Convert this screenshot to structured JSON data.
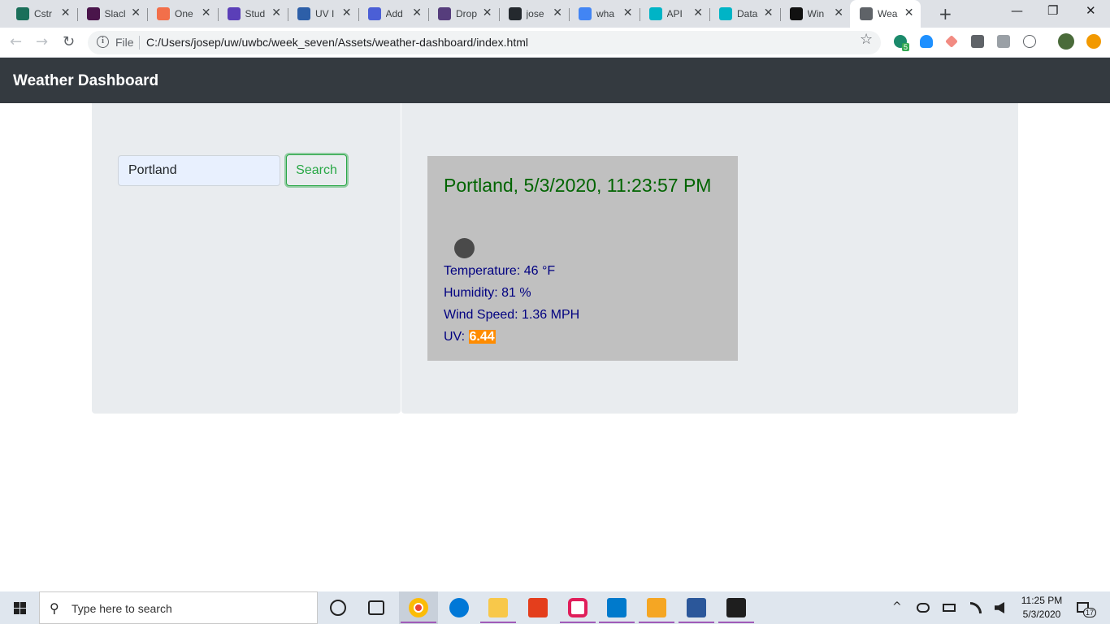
{
  "browser": {
    "tabs": [
      {
        "title": "Cstr",
        "color": "#1b6f5a"
      },
      {
        "title": "Slacl",
        "color": "#4a154b"
      },
      {
        "title": "One",
        "color": "#f26f4a"
      },
      {
        "title": "Stud",
        "color": "#5b3fb8"
      },
      {
        "title": "UV I",
        "color": "#2d5fa8"
      },
      {
        "title": "Add",
        "color": "#4b5fd6"
      },
      {
        "title": "Drop",
        "color": "#563d7c"
      },
      {
        "title": "jose",
        "color": "#24292e"
      },
      {
        "title": "wha",
        "color": "#4285f4"
      },
      {
        "title": "API",
        "color": "#00b4c6"
      },
      {
        "title": "Data",
        "color": "#00b4c6"
      },
      {
        "title": "Win",
        "color": "#111111"
      },
      {
        "title": "Wea",
        "color": "#5f6368"
      }
    ],
    "close_glyph": "✕",
    "new_tab_glyph": "+",
    "window_controls": {
      "minimize": "—",
      "restore": "❐",
      "close": "✕"
    },
    "nav": {
      "back": "←",
      "forward": "→",
      "reload": "↻"
    },
    "address": {
      "scheme_label": "File",
      "info_glyph": "i",
      "url": "C:/Users/josep/uw/uwbc/week_seven/Assets/weather-dashboard/index.html",
      "star_glyph": "☆"
    },
    "extension_badge": "5"
  },
  "app": {
    "brand": "Weather Dashboard",
    "search": {
      "value": "Portland",
      "button_label": "Search"
    },
    "current_weather": {
      "title": "Portland, 5/3/2020, 11:23:57 PM",
      "temperature": "Temperature: 46 °F",
      "humidity": "Humidity: 81 %",
      "wind": "Wind Speed: 1.36 MPH",
      "uv_label": "UV: ",
      "uv_value": "6.44",
      "icon": "weather-icon"
    },
    "colors": {
      "navbar": "#343a40",
      "panel": "#e9ecef",
      "card": "#c0c0c0",
      "title": "#006400",
      "stats": "#000080",
      "uv_badge": "#ff8c00",
      "search_button": "#28a745"
    }
  },
  "taskbar": {
    "search_placeholder": "Type here to search",
    "search_glyph": "⚲",
    "time": "11:25 PM",
    "date": "5/3/2020",
    "notification_count": "17",
    "tray_up_glyph": "^"
  }
}
